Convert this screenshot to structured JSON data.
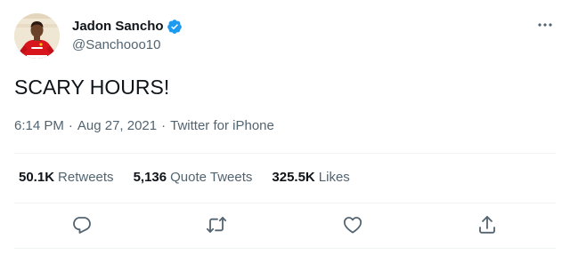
{
  "user": {
    "display_name": "Jadon Sancho",
    "handle": "@Sanchooo10",
    "verified": true
  },
  "tweet": {
    "text": "SCARY HOURS!",
    "time": "6:14 PM",
    "date": "Aug 27, 2021",
    "source": "Twitter for iPhone",
    "separator": "·"
  },
  "stats": {
    "retweets": {
      "count": "50.1K",
      "label": "Retweets"
    },
    "quote_tweets": {
      "count": "5,136",
      "label": "Quote Tweets"
    },
    "likes": {
      "count": "325.5K",
      "label": "Likes"
    }
  },
  "colors": {
    "text": "#0f1419",
    "secondary": "#536471",
    "verified_blue": "#1d9bf0",
    "divider": "#eff3f4"
  },
  "icons": {
    "more": "more-horizontal-icon",
    "reply": "reply-icon",
    "retweet": "retweet-icon",
    "like": "heart-icon",
    "share": "share-icon",
    "verified": "verified-badge-icon"
  }
}
